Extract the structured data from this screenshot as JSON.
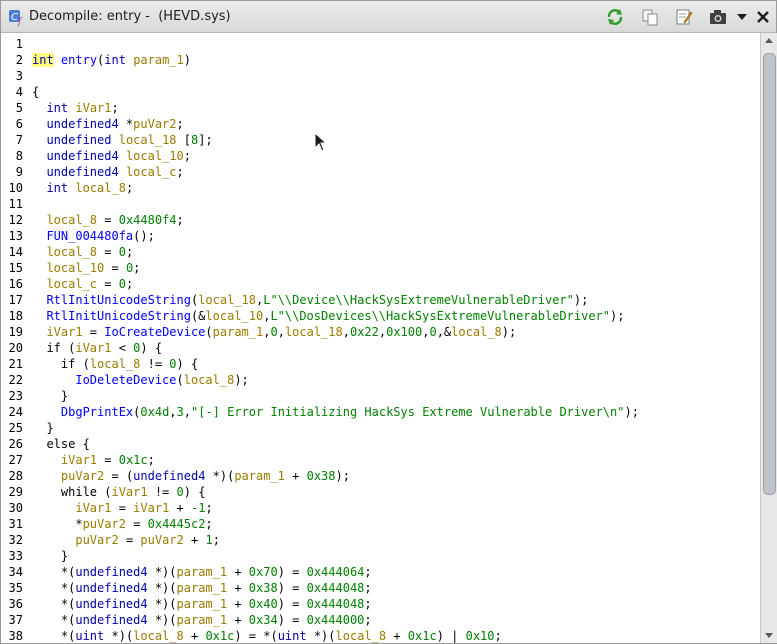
{
  "window": {
    "title": "Decompile: entry -  (HEVD.sys)",
    "icon": "decompiler-icon"
  },
  "toolbar": {
    "buttons": [
      {
        "name": "refresh-icon",
        "label": "Refresh"
      },
      {
        "name": "copy-icon",
        "label": "Copy"
      },
      {
        "name": "edit-icon",
        "label": "Edit Function Signature"
      },
      {
        "name": "snapshot-icon",
        "label": "Snapshot"
      },
      {
        "name": "dropdown-icon",
        "label": "More"
      },
      {
        "name": "close-icon",
        "label": "Close"
      }
    ]
  },
  "code_lines": [
    {
      "n": "1",
      "tokens": []
    },
    {
      "n": "2",
      "tokens": [
        {
          "t": "int",
          "c": "type hl"
        },
        {
          "t": " "
        },
        {
          "t": "entry",
          "c": "fn"
        },
        {
          "t": "("
        },
        {
          "t": "int",
          "c": "type"
        },
        {
          "t": " "
        },
        {
          "t": "param_1",
          "c": "var"
        },
        {
          "t": ")"
        }
      ]
    },
    {
      "n": "3",
      "tokens": []
    },
    {
      "n": "4",
      "tokens": [
        {
          "t": "{"
        }
      ]
    },
    {
      "n": "5",
      "tokens": [
        {
          "t": "  "
        },
        {
          "t": "int",
          "c": "type"
        },
        {
          "t": " "
        },
        {
          "t": "iVar1",
          "c": "var"
        },
        {
          "t": ";"
        }
      ]
    },
    {
      "n": "6",
      "tokens": [
        {
          "t": "  "
        },
        {
          "t": "undefined4",
          "c": "type"
        },
        {
          "t": " *"
        },
        {
          "t": "puVar2",
          "c": "var"
        },
        {
          "t": ";"
        }
      ]
    },
    {
      "n": "7",
      "tokens": [
        {
          "t": "  "
        },
        {
          "t": "undefined",
          "c": "type"
        },
        {
          "t": " "
        },
        {
          "t": "local_18",
          "c": "var"
        },
        {
          "t": " ["
        },
        {
          "t": "8",
          "c": "num"
        },
        {
          "t": "];"
        }
      ]
    },
    {
      "n": "8",
      "tokens": [
        {
          "t": "  "
        },
        {
          "t": "undefined4",
          "c": "type"
        },
        {
          "t": " "
        },
        {
          "t": "local_10",
          "c": "var"
        },
        {
          "t": ";"
        }
      ]
    },
    {
      "n": "9",
      "tokens": [
        {
          "t": "  "
        },
        {
          "t": "undefined4",
          "c": "type"
        },
        {
          "t": " "
        },
        {
          "t": "local_c",
          "c": "var"
        },
        {
          "t": ";"
        }
      ]
    },
    {
      "n": "10",
      "tokens": [
        {
          "t": "  "
        },
        {
          "t": "int",
          "c": "type"
        },
        {
          "t": " "
        },
        {
          "t": "local_8",
          "c": "var"
        },
        {
          "t": ";"
        }
      ]
    },
    {
      "n": "11",
      "tokens": []
    },
    {
      "n": "12",
      "tokens": [
        {
          "t": "  "
        },
        {
          "t": "local_8",
          "c": "var"
        },
        {
          "t": " = "
        },
        {
          "t": "0x4480f4",
          "c": "num"
        },
        {
          "t": ";"
        }
      ]
    },
    {
      "n": "13",
      "tokens": [
        {
          "t": "  "
        },
        {
          "t": "FUN_004480fa",
          "c": "fn"
        },
        {
          "t": "();"
        }
      ]
    },
    {
      "n": "14",
      "tokens": [
        {
          "t": "  "
        },
        {
          "t": "local_8",
          "c": "var"
        },
        {
          "t": " = "
        },
        {
          "t": "0",
          "c": "num"
        },
        {
          "t": ";"
        }
      ]
    },
    {
      "n": "15",
      "tokens": [
        {
          "t": "  "
        },
        {
          "t": "local_10",
          "c": "var"
        },
        {
          "t": " = "
        },
        {
          "t": "0",
          "c": "num"
        },
        {
          "t": ";"
        }
      ]
    },
    {
      "n": "16",
      "tokens": [
        {
          "t": "  "
        },
        {
          "t": "local_c",
          "c": "var"
        },
        {
          "t": " = "
        },
        {
          "t": "0",
          "c": "num"
        },
        {
          "t": ";"
        }
      ]
    },
    {
      "n": "17",
      "tokens": [
        {
          "t": "  "
        },
        {
          "t": "RtlInitUnicodeString",
          "c": "fn"
        },
        {
          "t": "("
        },
        {
          "t": "local_18",
          "c": "var"
        },
        {
          "t": ","
        },
        {
          "t": "L\"\\\\Device\\\\HackSysExtremeVulnerableDriver\"",
          "c": "str"
        },
        {
          "t": ");"
        }
      ]
    },
    {
      "n": "18",
      "tokens": [
        {
          "t": "  "
        },
        {
          "t": "RtlInitUnicodeString",
          "c": "fn"
        },
        {
          "t": "(&"
        },
        {
          "t": "local_10",
          "c": "var"
        },
        {
          "t": ","
        },
        {
          "t": "L\"\\\\DosDevices\\\\HackSysExtremeVulnerableDriver\"",
          "c": "str"
        },
        {
          "t": ");"
        }
      ]
    },
    {
      "n": "19",
      "tokens": [
        {
          "t": "  "
        },
        {
          "t": "iVar1",
          "c": "var"
        },
        {
          "t": " = "
        },
        {
          "t": "IoCreateDevice",
          "c": "fn"
        },
        {
          "t": "("
        },
        {
          "t": "param_1",
          "c": "var"
        },
        {
          "t": ","
        },
        {
          "t": "0",
          "c": "num"
        },
        {
          "t": ","
        },
        {
          "t": "local_18",
          "c": "var"
        },
        {
          "t": ","
        },
        {
          "t": "0x22",
          "c": "num"
        },
        {
          "t": ","
        },
        {
          "t": "0x100",
          "c": "num"
        },
        {
          "t": ","
        },
        {
          "t": "0",
          "c": "num"
        },
        {
          "t": ",&"
        },
        {
          "t": "local_8",
          "c": "var"
        },
        {
          "t": ");"
        }
      ]
    },
    {
      "n": "20",
      "tokens": [
        {
          "t": "  "
        },
        {
          "t": "if",
          "c": "kw"
        },
        {
          "t": " ("
        },
        {
          "t": "iVar1",
          "c": "var"
        },
        {
          "t": " < "
        },
        {
          "t": "0",
          "c": "num"
        },
        {
          "t": ") {"
        }
      ]
    },
    {
      "n": "21",
      "tokens": [
        {
          "t": "    "
        },
        {
          "t": "if",
          "c": "kw"
        },
        {
          "t": " ("
        },
        {
          "t": "local_8",
          "c": "var"
        },
        {
          "t": " != "
        },
        {
          "t": "0",
          "c": "num"
        },
        {
          "t": ") {"
        }
      ]
    },
    {
      "n": "22",
      "tokens": [
        {
          "t": "      "
        },
        {
          "t": "IoDeleteDevice",
          "c": "fn"
        },
        {
          "t": "("
        },
        {
          "t": "local_8",
          "c": "var"
        },
        {
          "t": ");"
        }
      ]
    },
    {
      "n": "23",
      "tokens": [
        {
          "t": "    }"
        }
      ]
    },
    {
      "n": "24",
      "tokens": [
        {
          "t": "    "
        },
        {
          "t": "DbgPrintEx",
          "c": "fn"
        },
        {
          "t": "("
        },
        {
          "t": "0x4d",
          "c": "num"
        },
        {
          "t": ","
        },
        {
          "t": "3",
          "c": "num"
        },
        {
          "t": ","
        },
        {
          "t": "\"[-] Error Initializing HackSys Extreme Vulnerable Driver\\n\"",
          "c": "str"
        },
        {
          "t": ");"
        }
      ]
    },
    {
      "n": "25",
      "tokens": [
        {
          "t": "  }"
        }
      ]
    },
    {
      "n": "26",
      "tokens": [
        {
          "t": "  "
        },
        {
          "t": "else",
          "c": "kw"
        },
        {
          "t": " {"
        }
      ]
    },
    {
      "n": "27",
      "tokens": [
        {
          "t": "    "
        },
        {
          "t": "iVar1",
          "c": "var"
        },
        {
          "t": " = "
        },
        {
          "t": "0x1c",
          "c": "num"
        },
        {
          "t": ";"
        }
      ]
    },
    {
      "n": "28",
      "tokens": [
        {
          "t": "    "
        },
        {
          "t": "puVar2",
          "c": "var"
        },
        {
          "t": " = ("
        },
        {
          "t": "undefined4",
          "c": "type"
        },
        {
          "t": " *)("
        },
        {
          "t": "param_1",
          "c": "var"
        },
        {
          "t": " + "
        },
        {
          "t": "0x38",
          "c": "num"
        },
        {
          "t": ");"
        }
      ]
    },
    {
      "n": "29",
      "tokens": [
        {
          "t": "    "
        },
        {
          "t": "while",
          "c": "kw"
        },
        {
          "t": " ("
        },
        {
          "t": "iVar1",
          "c": "var"
        },
        {
          "t": " != "
        },
        {
          "t": "0",
          "c": "num"
        },
        {
          "t": ") {"
        }
      ]
    },
    {
      "n": "30",
      "tokens": [
        {
          "t": "      "
        },
        {
          "t": "iVar1",
          "c": "var"
        },
        {
          "t": " = "
        },
        {
          "t": "iVar1",
          "c": "var"
        },
        {
          "t": " + "
        },
        {
          "t": "-1",
          "c": "num"
        },
        {
          "t": ";"
        }
      ]
    },
    {
      "n": "31",
      "tokens": [
        {
          "t": "      *"
        },
        {
          "t": "puVar2",
          "c": "var"
        },
        {
          "t": " = "
        },
        {
          "t": "0x4445c2",
          "c": "num"
        },
        {
          "t": ";"
        }
      ]
    },
    {
      "n": "32",
      "tokens": [
        {
          "t": "      "
        },
        {
          "t": "puVar2",
          "c": "var"
        },
        {
          "t": " = "
        },
        {
          "t": "puVar2",
          "c": "var"
        },
        {
          "t": " + "
        },
        {
          "t": "1",
          "c": "num"
        },
        {
          "t": ";"
        }
      ]
    },
    {
      "n": "33",
      "tokens": [
        {
          "t": "    }"
        }
      ]
    },
    {
      "n": "34",
      "tokens": [
        {
          "t": "    *("
        },
        {
          "t": "undefined4",
          "c": "type"
        },
        {
          "t": " *)("
        },
        {
          "t": "param_1",
          "c": "var"
        },
        {
          "t": " + "
        },
        {
          "t": "0x70",
          "c": "num"
        },
        {
          "t": ") = "
        },
        {
          "t": "0x444064",
          "c": "num"
        },
        {
          "t": ";"
        }
      ]
    },
    {
      "n": "35",
      "tokens": [
        {
          "t": "    *("
        },
        {
          "t": "undefined4",
          "c": "type"
        },
        {
          "t": " *)("
        },
        {
          "t": "param_1",
          "c": "var"
        },
        {
          "t": " + "
        },
        {
          "t": "0x38",
          "c": "num"
        },
        {
          "t": ") = "
        },
        {
          "t": "0x444048",
          "c": "num"
        },
        {
          "t": ";"
        }
      ]
    },
    {
      "n": "36",
      "tokens": [
        {
          "t": "    *("
        },
        {
          "t": "undefined4",
          "c": "type"
        },
        {
          "t": " *)("
        },
        {
          "t": "param_1",
          "c": "var"
        },
        {
          "t": " + "
        },
        {
          "t": "0x40",
          "c": "num"
        },
        {
          "t": ") = "
        },
        {
          "t": "0x444048",
          "c": "num"
        },
        {
          "t": ";"
        }
      ]
    },
    {
      "n": "37",
      "tokens": [
        {
          "t": "    *("
        },
        {
          "t": "undefined4",
          "c": "type"
        },
        {
          "t": " *)("
        },
        {
          "t": "param_1",
          "c": "var"
        },
        {
          "t": " + "
        },
        {
          "t": "0x34",
          "c": "num"
        },
        {
          "t": ") = "
        },
        {
          "t": "0x444000",
          "c": "num"
        },
        {
          "t": ";"
        }
      ]
    },
    {
      "n": "38",
      "tokens": [
        {
          "t": "    *("
        },
        {
          "t": "uint",
          "c": "type"
        },
        {
          "t": " *)("
        },
        {
          "t": "local_8",
          "c": "var"
        },
        {
          "t": " + "
        },
        {
          "t": "0x1c",
          "c": "num"
        },
        {
          "t": ") = *("
        },
        {
          "t": "uint",
          "c": "type"
        },
        {
          "t": " *)("
        },
        {
          "t": "local_8",
          "c": "var"
        },
        {
          "t": " + "
        },
        {
          "t": "0x1c",
          "c": "num"
        },
        {
          "t": ") | "
        },
        {
          "t": "0x10",
          "c": "num"
        },
        {
          "t": ";"
        }
      ]
    }
  ],
  "colors": {
    "type": "#0000aa",
    "function": "#0000ff",
    "variable": "#9a7b00",
    "number": "#008000",
    "highlight": "#ffff80"
  }
}
